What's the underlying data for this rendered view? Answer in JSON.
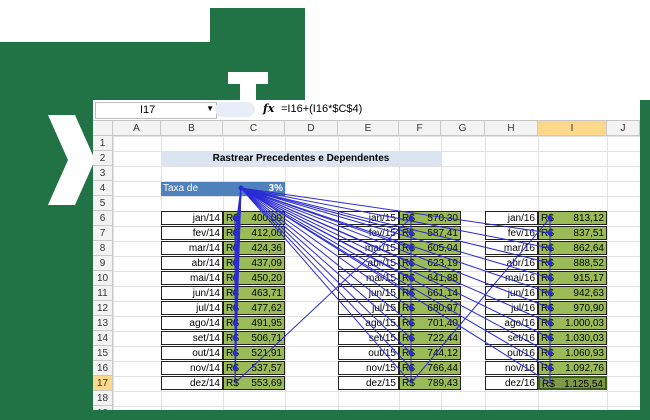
{
  "name_box": "I17",
  "formula": "=I16+(I16*$C$4)",
  "columns": [
    "A",
    "B",
    "C",
    "D",
    "E",
    "F",
    "G",
    "H",
    "I",
    "J"
  ],
  "rows": [
    "1",
    "2",
    "3",
    "4",
    "5",
    "6",
    "7",
    "8",
    "9",
    "10",
    "11",
    "12",
    "13",
    "14",
    "15",
    "16",
    "17",
    "18",
    "19"
  ],
  "title": "Rastrear Precedentes e Dependentes",
  "rate": {
    "label": "Taxa de Juros",
    "value": "3%"
  },
  "currency": "R$",
  "table1": {
    "months": [
      "jan/14",
      "fev/14",
      "mar/14",
      "abr/14",
      "mai/14",
      "jun/14",
      "jul/14",
      "ago/14",
      "set/14",
      "out/14",
      "nov/14",
      "dez/14"
    ],
    "values": [
      "400,00",
      "412,00",
      "424,36",
      "437,09",
      "450,20",
      "463,71",
      "477,62",
      "491,95",
      "506,71",
      "521,91",
      "537,57",
      "553,69"
    ]
  },
  "table2": {
    "months": [
      "jan/15",
      "fev/15",
      "mar/15",
      "abr/15",
      "mai/15",
      "jun/15",
      "jul/15",
      "ago/15",
      "set/15",
      "out/15",
      "nov/15",
      "dez/15"
    ],
    "values": [
      "570,30",
      "587,41",
      "605,04",
      "623,19",
      "641,88",
      "661,14",
      "680,97",
      "701,40",
      "722,44",
      "744,12",
      "766,44",
      "789,43"
    ]
  },
  "table3": {
    "months": [
      "jan/16",
      "fev/16",
      "mar/16",
      "abr/16",
      "mai/16",
      "jun/16",
      "jul/16",
      "ago/16",
      "set/16",
      "out/16",
      "nov/16",
      "dez/16"
    ],
    "values": [
      "813,12",
      "837,51",
      "862,64",
      "888,52",
      "915,17",
      "942,63",
      "970,90",
      "1.000,03",
      "1.030,03",
      "1.060,93",
      "1.092,76",
      "1.125,54"
    ]
  },
  "colors": {
    "brand": "#217346",
    "header_blue": "#4f81bd",
    "money_green": "#9bbb59",
    "arrow_blue": "#2b2bd6"
  }
}
